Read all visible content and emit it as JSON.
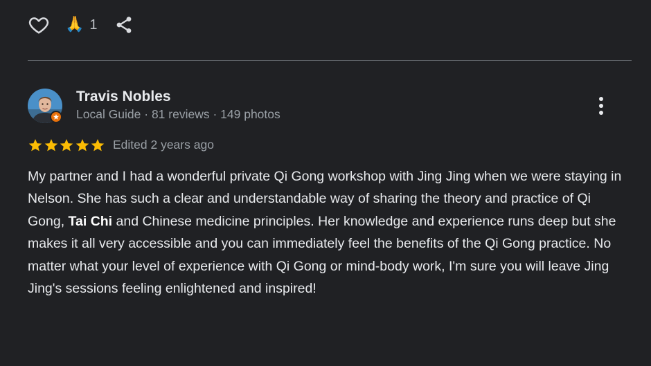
{
  "actions": {
    "like_icon": "heart-outline-icon",
    "reaction_emoji": "🙏",
    "reaction_count": "1",
    "share_icon": "share-icon"
  },
  "review": {
    "reviewer_name": "Travis Nobles",
    "reviewer_meta": "Local Guide · 81 reviews · 149 photos",
    "badge_icon": "local-guide-badge-icon",
    "rating": 5,
    "rating_max": 5,
    "edited": "Edited 2 years ago",
    "text_parts": [
      "My partner and I had a wonderful private Qi Gong workshop with Jing Jing when we were staying in Nelson. She has such a clear and understandable way of sharing the theory and practice of Qi Gong, ",
      "Tai Chi",
      " and Chinese medicine principles. Her knowledge and experience runs deep but she makes it all very accessible and you can immediately feel the benefits of the Qi Gong practice. No matter what your level of experience with Qi Gong or mind-body work, I'm sure you will leave Jing Jing's sessions feeling enlightened and inspired!"
    ]
  },
  "colors": {
    "background": "#202124",
    "text": "#e8eaed",
    "secondary_text": "#9aa0a6",
    "star": "#fbbc04",
    "badge": "#e8710a"
  }
}
